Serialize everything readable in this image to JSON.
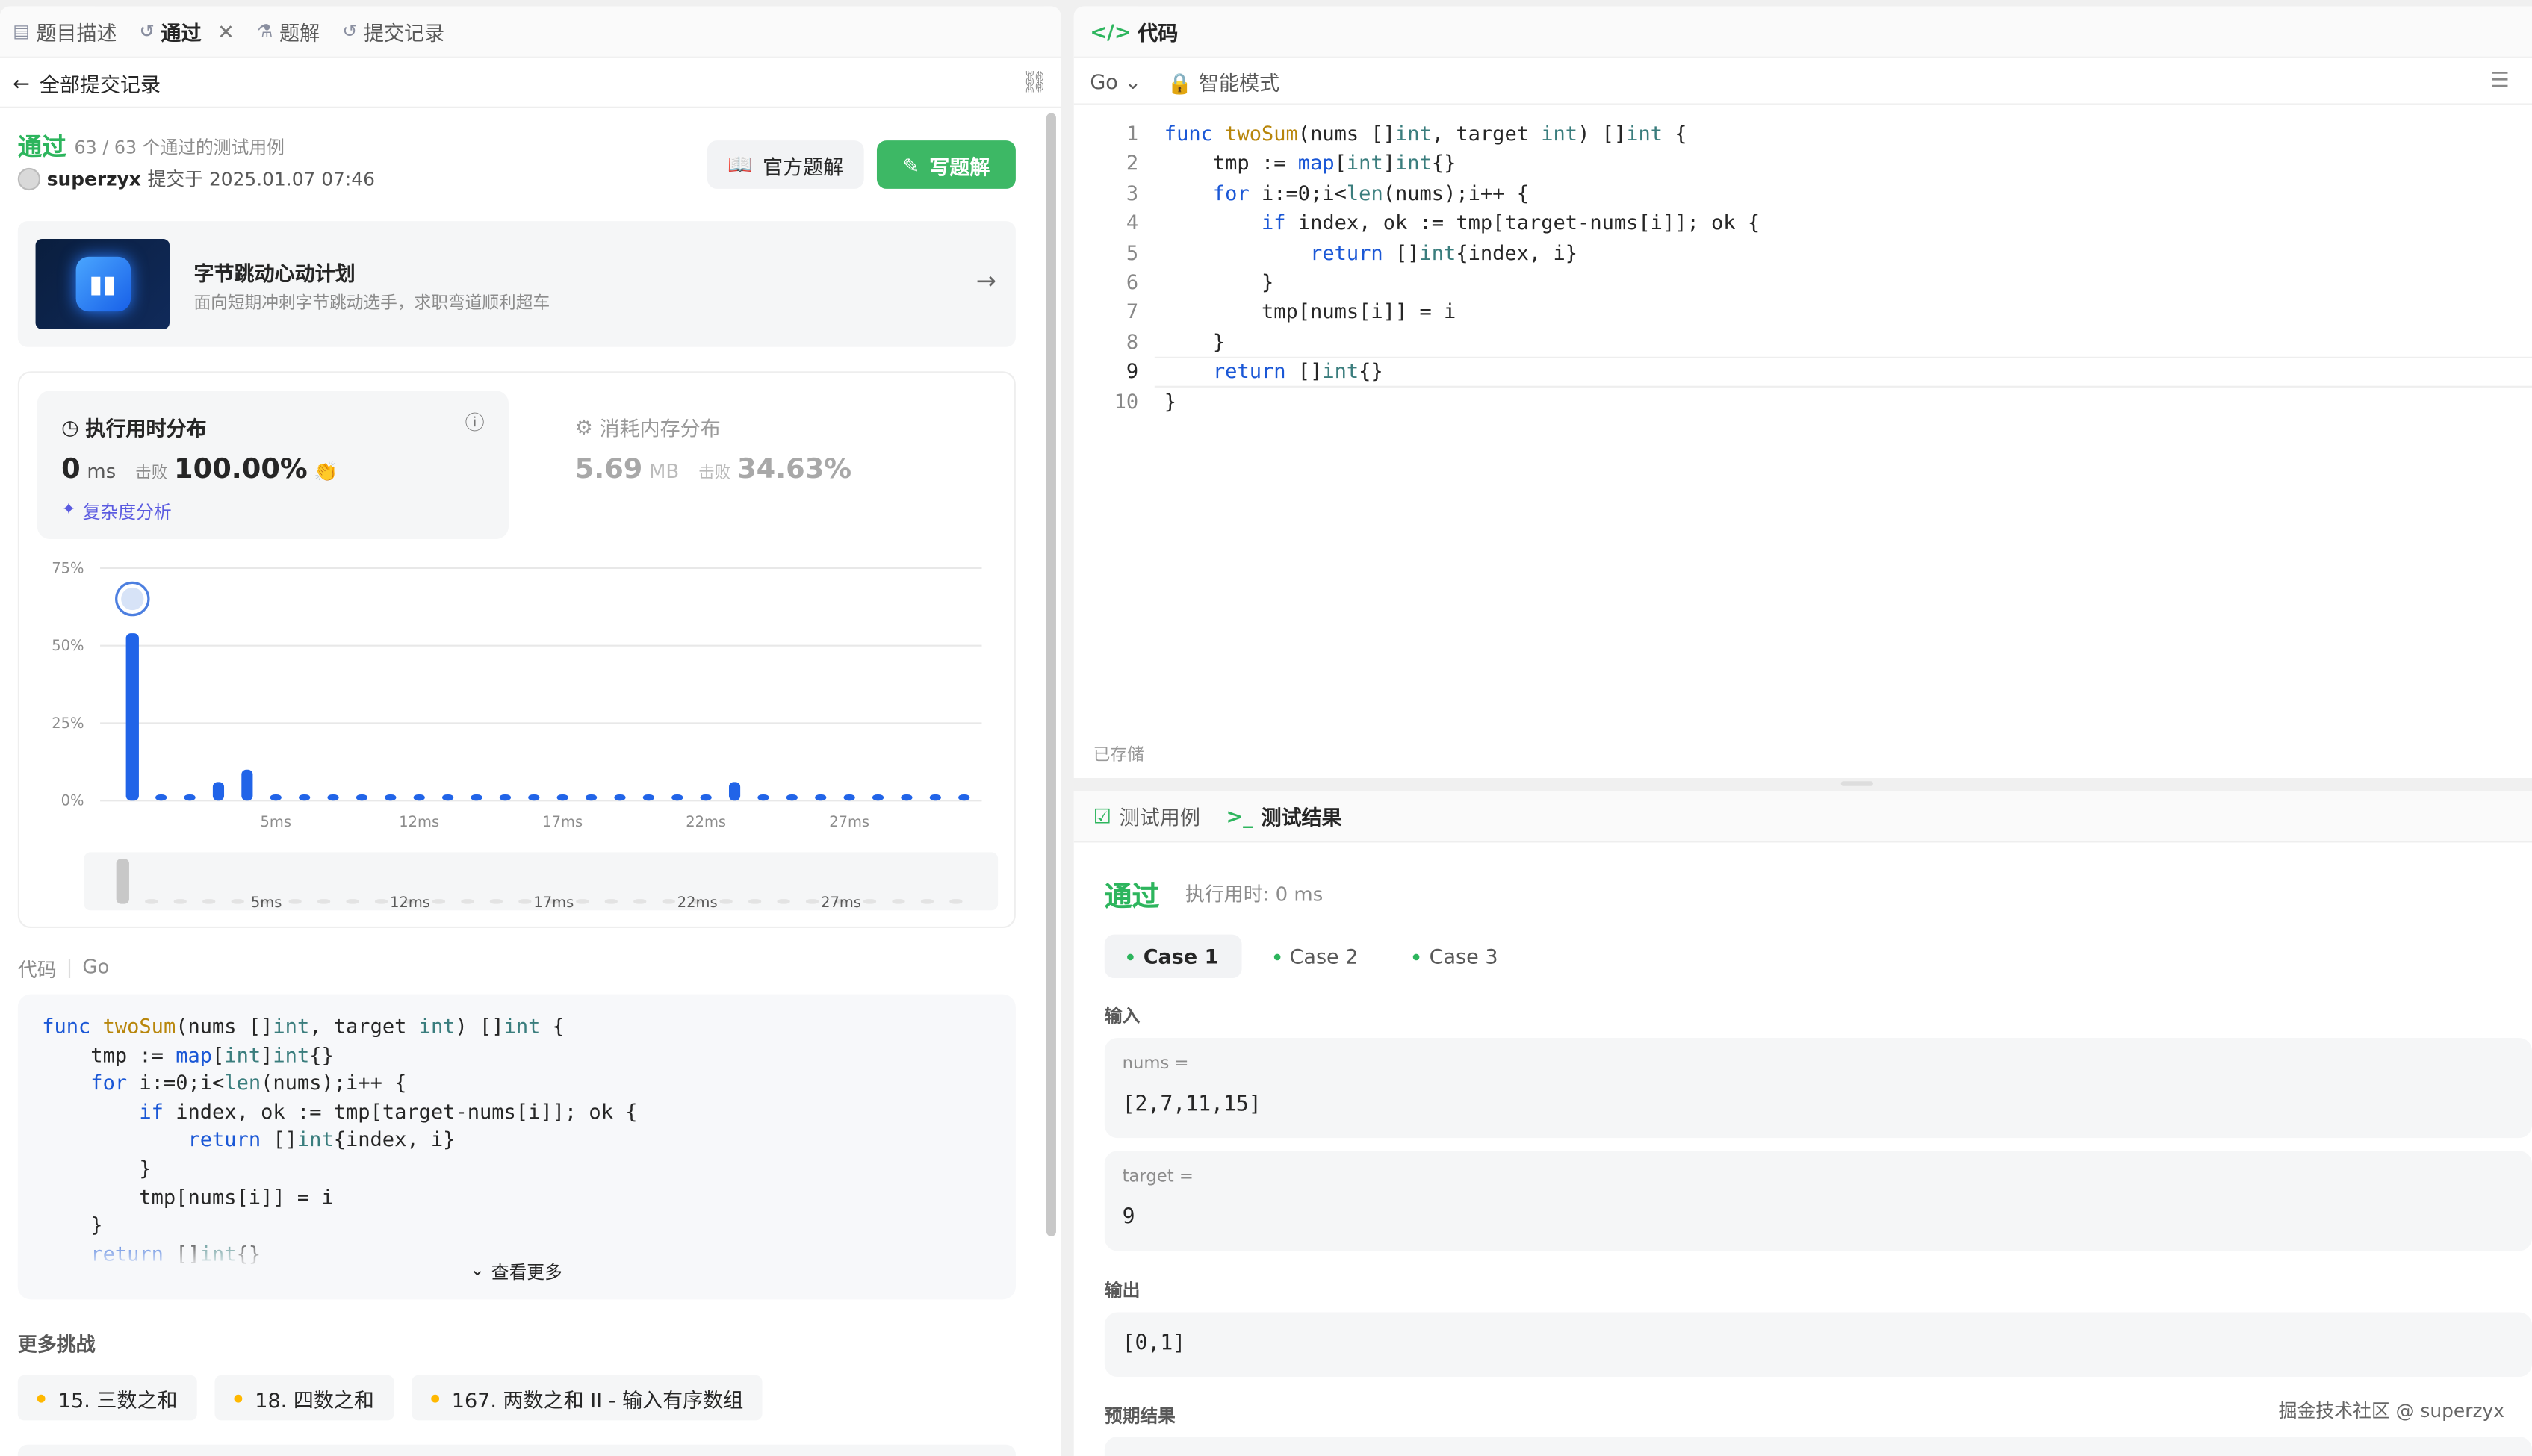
{
  "left": {
    "tabs": [
      {
        "label": "题目描述",
        "icon": "doc-icon"
      },
      {
        "label": "通过",
        "icon": "history-icon",
        "closable": true
      },
      {
        "label": "题解",
        "icon": "flask-icon"
      },
      {
        "label": "提交记录",
        "icon": "history-icon"
      }
    ],
    "back_label": "全部提交记录",
    "status": "通过",
    "testcases": "63 / 63 个通过的测试用例",
    "user": "superzyx",
    "submitted": "提交于 2025.01.07 07:46",
    "btn_official": "官方题解",
    "btn_write": "写题解",
    "promo": {
      "title": "字节跳动心动计划",
      "subtitle": "面向短期冲刺字节跳动选手，求职弯道顺利超车"
    },
    "runtime": {
      "title": "执行用时分布",
      "value": "0",
      "unit": "ms",
      "beat_label": "击败",
      "beat": "100.00%",
      "complexity": "复杂度分析"
    },
    "memory": {
      "title": "消耗内存分布",
      "value": "5.69",
      "unit": "MB",
      "beat_label": "击败",
      "beat": "34.63%"
    },
    "code_label": "代码",
    "code_lang": "Go",
    "see_more": "查看更多",
    "more_title": "更多挑战",
    "challenges": [
      "15. 三数之和",
      "18. 四数之和",
      "167. 两数之和 II - 输入有序数组"
    ]
  },
  "chart_data": {
    "type": "bar",
    "ylabel_ticks": [
      "75%",
      "50%",
      "25%",
      "0%"
    ],
    "ylim": [
      0,
      75
    ],
    "x_ticks": [
      "5ms",
      "12ms",
      "17ms",
      "22ms",
      "27ms"
    ],
    "x_tick_index": [
      5,
      10,
      15,
      20,
      25
    ],
    "values": [
      54,
      2,
      2,
      6,
      10,
      2,
      2,
      2,
      2,
      2,
      2,
      2,
      2,
      2,
      2,
      2,
      2,
      2,
      2,
      2,
      2,
      6,
      2,
      2,
      2,
      2,
      2,
      2,
      2,
      2
    ],
    "highlight_index": 0,
    "grid": true
  },
  "editor": {
    "title": "代码",
    "lang": "Go",
    "mode": "智能模式",
    "saved": "已存储",
    "lines": [
      "func twoSum(nums []int, target int) []int {",
      "    tmp := map[int]int{}",
      "    for i:=0;i<len(nums);i++ {",
      "        if index, ok := tmp[target-nums[i]]; ok {",
      "            return []int{index, i}",
      "        }",
      "        tmp[nums[i]] = i",
      "    }",
      "    return []int{}",
      "}"
    ]
  },
  "results": {
    "tab_cases": "测试用例",
    "tab_result": "测试结果",
    "status": "通过",
    "time": "执行用时: 0 ms",
    "cases": [
      "Case 1",
      "Case 2",
      "Case 3"
    ],
    "input_label": "输入",
    "nums_label": "nums =",
    "nums_value": "[2,7,11,15]",
    "target_label": "target =",
    "target_value": "9",
    "output_label": "输出",
    "output_value": "[0,1]",
    "expected_label": "预期结果",
    "watermark": "掘金技术社区 @ superzyx"
  }
}
